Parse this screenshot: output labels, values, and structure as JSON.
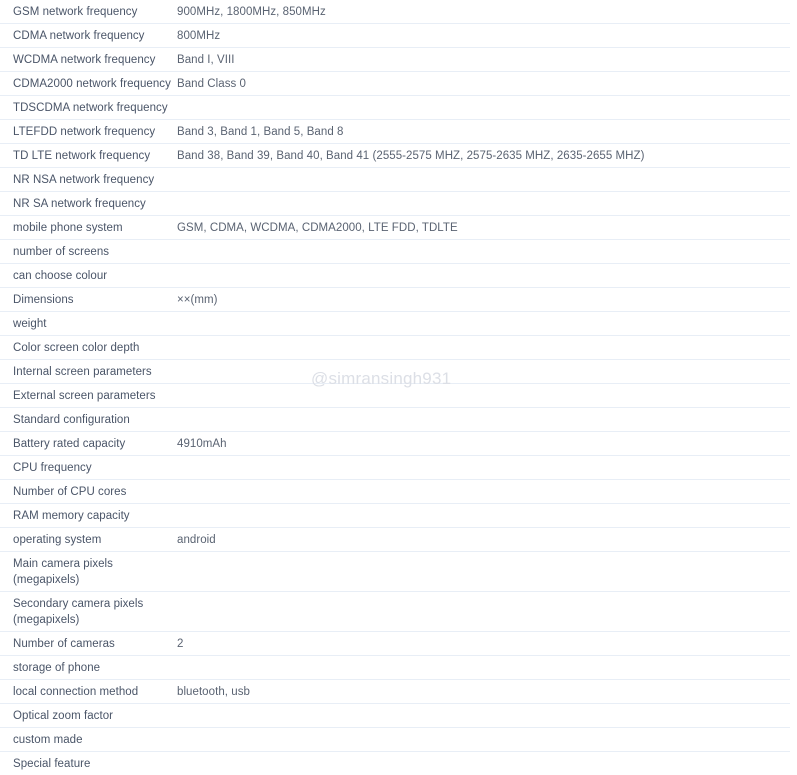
{
  "watermark": {
    "text": "@simransingh931"
  },
  "table": {
    "rows": [
      {
        "label": "GSM network frequency",
        "value": "900MHz, 1800MHz, 850MHz"
      },
      {
        "label": "CDMA network frequency",
        "value": "800MHz"
      },
      {
        "label": "WCDMA network frequency",
        "value": "Band I, VIII"
      },
      {
        "label": "CDMA2000 network frequency",
        "value": "Band Class 0"
      },
      {
        "label": "TDSCDMA network frequency",
        "value": ""
      },
      {
        "label": "LTEFDD network frequency",
        "value": "Band 3, Band 1, Band 5, Band 8"
      },
      {
        "label": "TD LTE network frequency",
        "value": "Band 38, Band 39, Band 40, Band 41 (2555-2575 MHZ, 2575-2635 MHZ, 2635-2655 MHZ)"
      },
      {
        "label": "NR NSA network frequency",
        "value": ""
      },
      {
        "label": "NR SA network frequency",
        "value": ""
      },
      {
        "label": "mobile phone system",
        "value": "GSM, CDMA, WCDMA, CDMA2000, LTE FDD, TDLTE"
      },
      {
        "label": "number of screens",
        "value": ""
      },
      {
        "label": "can choose colour",
        "value": ""
      },
      {
        "label": "Dimensions",
        "value": "××(mm)"
      },
      {
        "label": "weight",
        "value": ""
      },
      {
        "label": "Color screen color depth",
        "value": ""
      },
      {
        "label": "Internal screen parameters",
        "value": ""
      },
      {
        "label": "External screen parameters",
        "value": ""
      },
      {
        "label": "Standard configuration",
        "value": ""
      },
      {
        "label": "Battery rated capacity",
        "value": "4910mAh"
      },
      {
        "label": "CPU frequency",
        "value": ""
      },
      {
        "label": "Number of CPU cores",
        "value": ""
      },
      {
        "label": "RAM memory capacity",
        "value": ""
      },
      {
        "label": "operating system",
        "value": "android"
      },
      {
        "label": "Main camera pixels (megapixels)",
        "value": ""
      },
      {
        "label": "Secondary camera pixels (megapixels)",
        "value": ""
      },
      {
        "label": "Number of cameras",
        "value": "2"
      },
      {
        "label": "storage of phone",
        "value": ""
      },
      {
        "label": "local connection method",
        "value": "bluetooth, usb"
      },
      {
        "label": "Optical zoom factor",
        "value": ""
      },
      {
        "label": "custom made",
        "value": ""
      },
      {
        "label": "Special feature",
        "value": ""
      }
    ]
  }
}
